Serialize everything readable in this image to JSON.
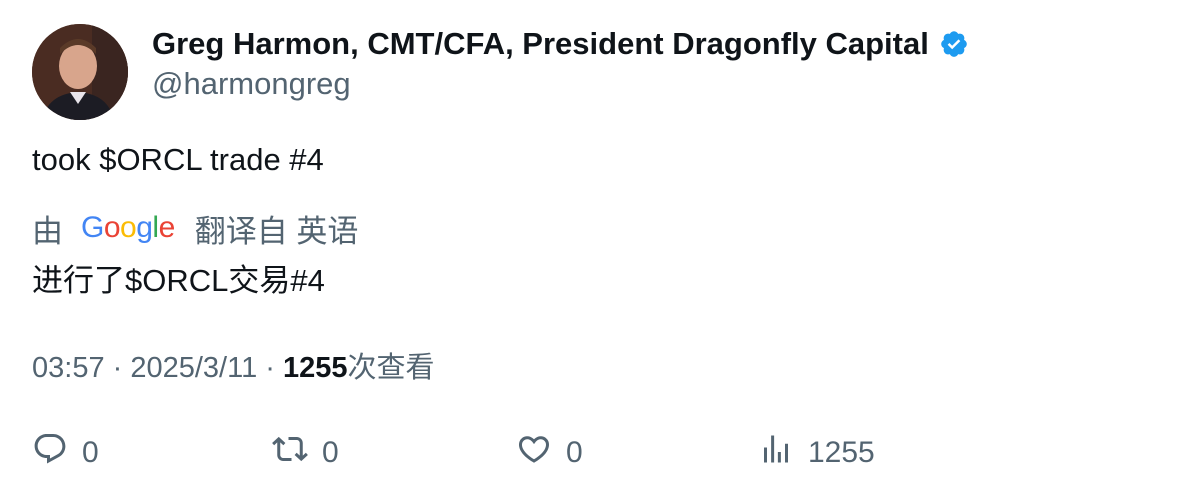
{
  "author": {
    "display_name": "Greg Harmon, CMT/CFA, President Dragonfly Capital",
    "handle": "@harmongreg",
    "verified_icon": "verified-badge-icon",
    "verified_color": "#1d9bf0"
  },
  "tweet": {
    "text": "took $ORCL trade #4"
  },
  "translation": {
    "prefix": "由",
    "provider_logo": "Google",
    "suffix": "翻译自 英语",
    "text": "进行了$ORCL交易#4"
  },
  "meta": {
    "time": "03:57",
    "separator": " · ",
    "date": "2025/3/11",
    "views_count": "1255",
    "views_label": "次查看"
  },
  "actions": {
    "reply": {
      "icon": "reply-icon",
      "count": "0"
    },
    "retweet": {
      "icon": "retweet-icon",
      "count": "0"
    },
    "like": {
      "icon": "heart-icon",
      "count": "0"
    },
    "views": {
      "icon": "analytics-icon",
      "count": "1255"
    }
  },
  "colors": {
    "text_primary": "#0f1419",
    "text_secondary": "#536471"
  }
}
